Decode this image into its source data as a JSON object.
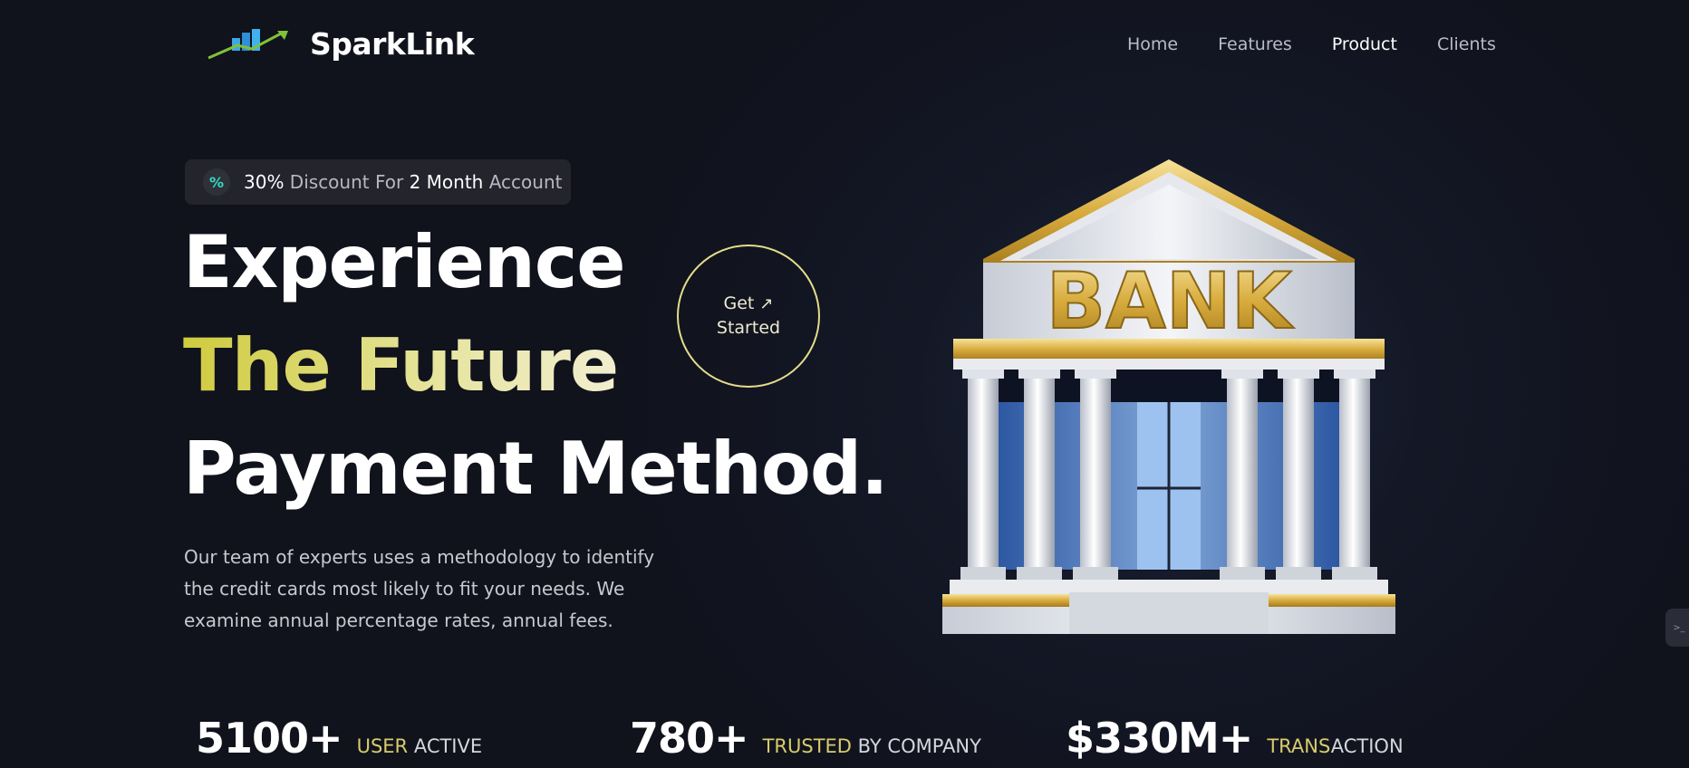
{
  "brand": {
    "name": "SparkLink"
  },
  "nav": {
    "items": [
      {
        "label": "Home",
        "active": false
      },
      {
        "label": "Features",
        "active": false
      },
      {
        "label": "Product",
        "active": true
      },
      {
        "label": "Clients",
        "active": false
      }
    ]
  },
  "badge": {
    "icon": "percent-icon",
    "part1": "30%",
    "part2": " Discount For ",
    "part3": "2 Month",
    "part4": " Account"
  },
  "hero": {
    "line1": "Experience",
    "line2": "The Future",
    "line3": "Payment Method.",
    "cta_line1": "Get",
    "cta_line2": "Started",
    "description": "Our team of experts uses a methodology to identify the credit cards most likely to fit your needs. We examine annual percentage rates, annual fees."
  },
  "illustration": {
    "sign_text": "BANK",
    "icon": "bank-building-icon"
  },
  "stats": [
    {
      "value": "5100+",
      "label_highlight": "USER",
      "label_rest": " ACTIVE"
    },
    {
      "value": "780+",
      "label_highlight": "TRUSTED",
      "label_rest": " BY COMPANY"
    },
    {
      "value": "$330M+",
      "label_highlight": "TRANS",
      "label_rest": "ACTION"
    }
  ],
  "colors": {
    "background": "#141826",
    "accent_yellow": "#d8cc6c",
    "teal": "#36d9c6"
  }
}
